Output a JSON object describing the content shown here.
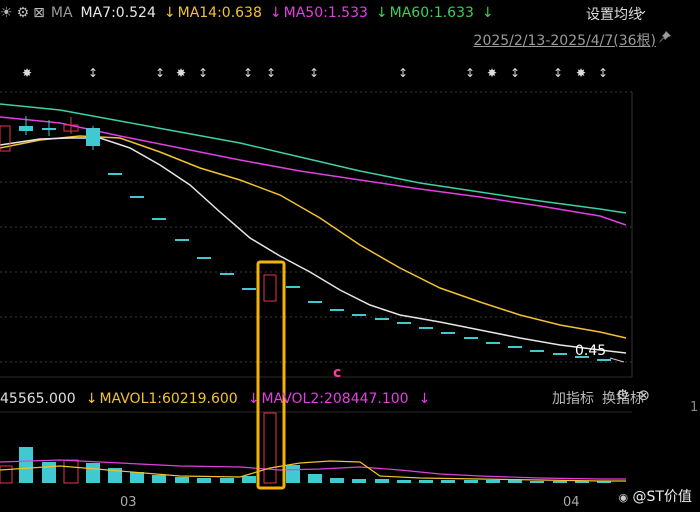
{
  "colors": {
    "ma7": "#e6e6e6",
    "ma14": "#f2c230",
    "ma50": "#e040e0",
    "ma60": "#3fcfa8",
    "up": "#e8334a",
    "down": "#40c9d0",
    "highlight": "#f2b400",
    "grid": "#3a3a3a"
  },
  "topbar": {
    "sun_icon": "☀",
    "gear_icon": "⚙",
    "close_icon": "⊠",
    "ma_label": "MA",
    "ma7": "MA7:0.524",
    "ma14_arrow": "↓",
    "ma14": "MA14:0.638",
    "ma50_arrow": "↓",
    "ma50": "MA50:1.533",
    "ma60_arrow": "↓",
    "ma60": "MA60:1.633",
    "ma60_arrow2": "↓",
    "settings_label": "设置均线",
    "settings_chevron": "⌄"
  },
  "date_range": "2025/2/13-2025/4/7(36根)",
  "pin_icon": "📌",
  "price_label": "0.45",
  "c_marker": "c",
  "volume_bar": {
    "vol_value": "45565.000",
    "mavol1_arrow": "↓",
    "mavol1": "MAVOL1:60219.600",
    "mavol2_arrow": "↓",
    "mavol2": "MAVOL2:208447.100",
    "mavol2_arrow2": "↓",
    "add_indicator": "加指标",
    "switch_indicator": "换指标",
    "gear_icon": "⚙",
    "close_icon": "⊗"
  },
  "x_ticks": [
    "03",
    "04"
  ],
  "right_axis_partial": "1",
  "watermark": "@ST价值",
  "watermark_icon": "微博"
}
